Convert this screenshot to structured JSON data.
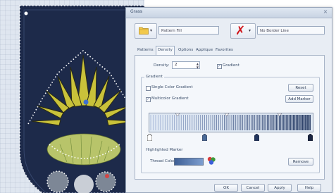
{
  "dialog": {
    "title": "Grass",
    "close_glyph": "×"
  },
  "top": {
    "pattern_icon": "folder-icon",
    "pattern_field": "Pattern Fill",
    "border_icon": "red-x-icon",
    "border_field": "No Border Line"
  },
  "tabs": [
    {
      "label": "Patterns",
      "active": false
    },
    {
      "label": "Density",
      "active": true
    },
    {
      "label": "Options",
      "active": false
    },
    {
      "label": "Applique",
      "active": false
    },
    {
      "label": "Favorites",
      "active": false
    }
  ],
  "density": {
    "label": "Density:",
    "value": "2",
    "gradient_label": "Gradient",
    "gradient_checked": true
  },
  "gradient": {
    "group_label": "Gradient",
    "single_label": "Single Color Gradient",
    "single_checked": false,
    "multi_label": "Multicolor Gradient",
    "multi_checked": true,
    "reset_label": "Reset",
    "add_marker_label": "Add Marker"
  },
  "marker": {
    "section_label": "Highlighted Marker",
    "thread_color_label": "Thread Color",
    "remove_label": "Remove"
  },
  "buttons": {
    "ok": "OK",
    "cancel": "Cancel",
    "apply": "Apply",
    "help": "Help"
  },
  "colors": {
    "accent_blue": "#3f5f95",
    "x_red": "#d0161b",
    "leaf_yellow": "#c9c23a",
    "canvas_navy": "#1d2a4a"
  }
}
